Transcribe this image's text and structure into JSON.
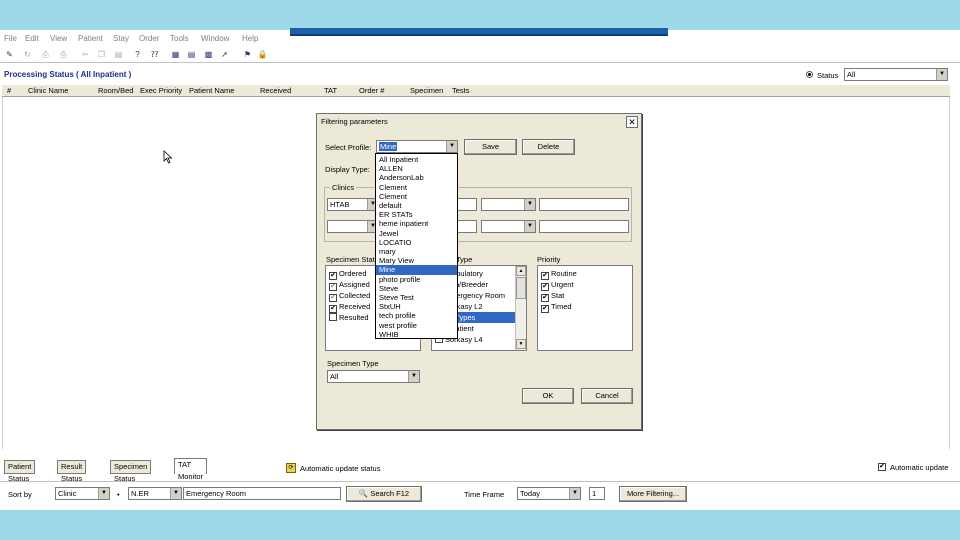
{
  "menubar": [
    "File",
    "Edit",
    "View",
    "Patient",
    "Stay",
    "Order",
    "Tools",
    "Window",
    "Help"
  ],
  "toolbar_icons": [
    "edit-icon",
    "refresh-icon",
    "print-preview-icon",
    "print-icon",
    "cut-icon",
    "copy-icon",
    "paste-icon",
    "help-icon",
    "context-help-icon",
    "chart-icon",
    "report-icon",
    "grid-icon",
    "arrow-icon",
    "flag-icon",
    "lock-icon"
  ],
  "header": {
    "title": "Processing Status ( All Inpatient )",
    "status_label": "Status",
    "status_value": "All"
  },
  "columns": [
    "#",
    "Clinic Name",
    "Room/Bed",
    "Exec Priority",
    "Patient Name",
    "Received",
    "TAT",
    "Order #",
    "Specimen",
    "Tests"
  ],
  "dialog": {
    "title": "Filtering parameters",
    "select_profile_label": "Select Profile:",
    "select_profile_value": "Mine",
    "save_label": "Save",
    "delete_label": "Delete",
    "display_type_label": "Display Type:",
    "clinics_group_label": "Clinics",
    "clinic_value": "HTAB",
    "specimen_status_label": "Specimen Status",
    "specimen_statuses": [
      {
        "label": "Ordered",
        "checked": true
      },
      {
        "label": "Assigned",
        "checked": true
      },
      {
        "label": "Collected",
        "checked": true
      },
      {
        "label": "Received",
        "checked": true
      },
      {
        "label": "Resulted",
        "checked": false
      }
    ],
    "type_label": "Type",
    "types": [
      {
        "label": "Ambulatory",
        "checked": true,
        "selected": false
      },
      {
        "label": "Oph/Breeder",
        "checked": true,
        "selected": false
      },
      {
        "label": "Emergency Room",
        "checked": true,
        "selected": false
      },
      {
        "label": "Sorkasy L2",
        "checked": true,
        "selected": false
      },
      {
        "label": "All Types",
        "checked": true,
        "selected": true
      },
      {
        "label": "Inpatient",
        "checked": true,
        "selected": false
      },
      {
        "label": "Sorkasy L4",
        "checked": false,
        "selected": false
      }
    ],
    "priority_label": "Priority",
    "priorities": [
      {
        "label": "Routine",
        "checked": true
      },
      {
        "label": "Urgent",
        "checked": true
      },
      {
        "label": "Stat",
        "checked": true
      },
      {
        "label": "Timed",
        "checked": true
      }
    ],
    "specimen_type_label": "Specimen Type",
    "specimen_type_value": "All",
    "ok_label": "OK",
    "cancel_label": "Cancel",
    "profile_options": [
      "All Inpatient",
      "ALLEN",
      "AndersonLab",
      "Clement",
      "Clement",
      "default",
      "ER STATs",
      "heme inpatient",
      "Jewel",
      "LOCATIO",
      "mary",
      "Mary View",
      "Mine",
      "photo profile",
      "Steve",
      "Steve Test",
      "StxUH",
      "tech profile",
      "west profile",
      "WHIB"
    ],
    "profile_selected_index": 12
  },
  "tabs": [
    "Patient Status",
    "Result Status",
    "Specimen Status",
    "TAT Monitor"
  ],
  "active_tab": 3,
  "status_message": "Automatic update status",
  "auto_update_label": "Automatic update",
  "bottom": {
    "sort_label": "Sort by",
    "sort_value": "Clinic",
    "clinic_code": "N.ER",
    "clinic_name": "Emergency Room",
    "search_label": "Search F12",
    "time_label": "Time Frame",
    "time_value": "Today",
    "days_value": "1",
    "more_filtering_label": "More Filtering..."
  }
}
